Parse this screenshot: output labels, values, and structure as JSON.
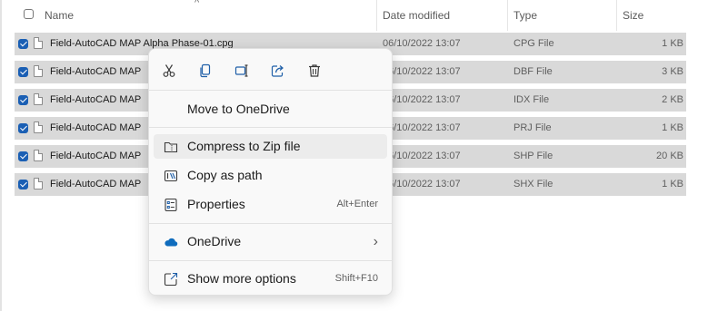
{
  "header": {
    "name": "Name",
    "date_modified": "Date modified",
    "type": "Type",
    "size": "Size",
    "sort_glyph": "^"
  },
  "files": [
    {
      "name": "Field-AutoCAD MAP Alpha Phase-01.cpg",
      "date": "06/10/2022 13:07",
      "type": "CPG File",
      "size": "1 KB",
      "selected": true
    },
    {
      "name": "Field-AutoCAD MAP",
      "date": "06/10/2022 13:07",
      "type": "DBF File",
      "size": "3 KB",
      "selected": true
    },
    {
      "name": "Field-AutoCAD MAP",
      "date": "06/10/2022 13:07",
      "type": "IDX File",
      "size": "2 KB",
      "selected": true
    },
    {
      "name": "Field-AutoCAD MAP",
      "date": "06/10/2022 13:07",
      "type": "PRJ File",
      "size": "1 KB",
      "selected": true
    },
    {
      "name": "Field-AutoCAD MAP",
      "date": "06/10/2022 13:07",
      "type": "SHP File",
      "size": "20 KB",
      "selected": true
    },
    {
      "name": "Field-AutoCAD MAP",
      "date": "06/10/2022 13:07",
      "type": "SHX File",
      "size": "1 KB",
      "selected": true
    }
  ],
  "context_menu": {
    "quick_actions": [
      "cut-icon",
      "copy-icon",
      "rename-icon",
      "share-icon",
      "delete-icon"
    ],
    "items": [
      {
        "label": "Move to OneDrive",
        "shortcut": "",
        "icon": ""
      },
      {
        "label": "Compress to Zip file",
        "shortcut": "",
        "icon": "zip-folder-icon",
        "highlighted": true
      },
      {
        "label": "Copy as path",
        "shortcut": "",
        "icon": "copy-path-icon"
      },
      {
        "label": "Properties",
        "shortcut": "Alt+Enter",
        "icon": "properties-icon"
      },
      {
        "label": "OneDrive",
        "shortcut": "",
        "icon": "onedrive-cloud-icon",
        "submenu": true
      },
      {
        "label": "Show more options",
        "shortcut": "Shift+F10",
        "icon": "show-more-options-icon"
      }
    ],
    "submenu_glyph": "›"
  },
  "colors": {
    "checkbox_accent": "#1a5fb4",
    "selected_row": "#d9d9d9",
    "onedrive_blue": "#0f6cbd"
  }
}
